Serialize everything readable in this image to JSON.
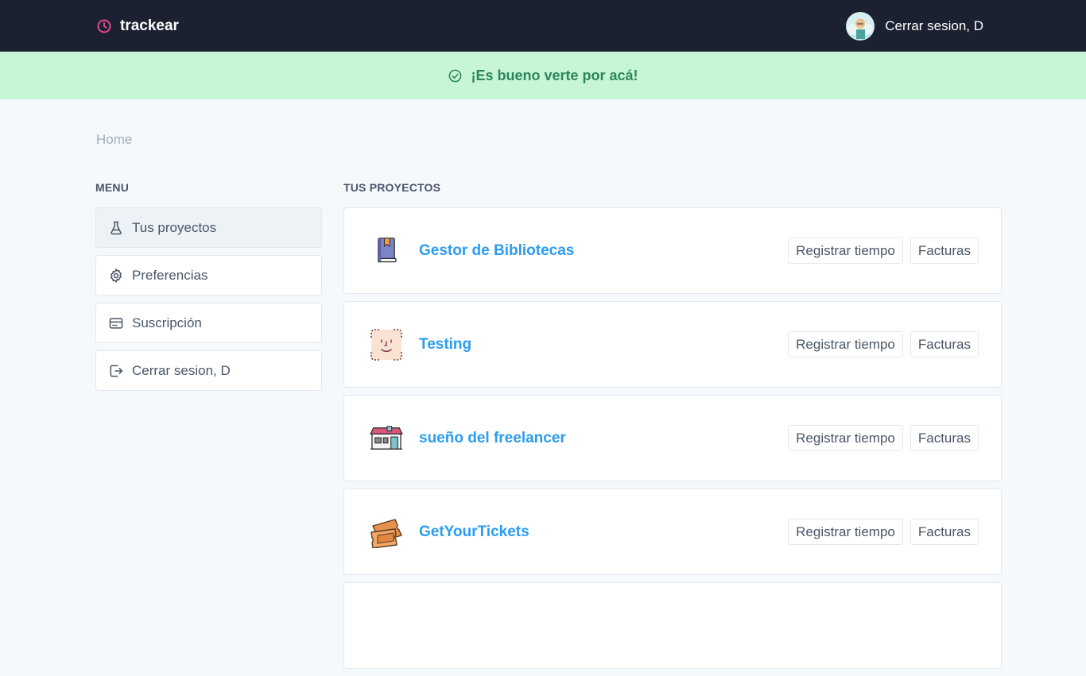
{
  "app": {
    "name": "trackear"
  },
  "header": {
    "user_label": "Cerrar sesion, D"
  },
  "flash": {
    "message": "¡Es bueno verte por acá!"
  },
  "breadcrumb": {
    "home": "Home"
  },
  "menu": {
    "title": "MENU",
    "items": [
      {
        "label": "Tus proyectos",
        "icon": "flask-icon"
      },
      {
        "label": "Preferencias",
        "icon": "gear-icon"
      },
      {
        "label": "Suscripción",
        "icon": "credit-card-icon"
      },
      {
        "label": "Cerrar sesion, D",
        "icon": "logout-icon"
      }
    ]
  },
  "projects": {
    "title": "TUS PROYECTOS",
    "items": [
      {
        "name": "Gestor de Bibliotecas",
        "icon": "book-icon",
        "register": "Registrar tiempo",
        "invoices": "Facturas"
      },
      {
        "name": "Testing",
        "icon": "face-scan-icon",
        "register": "Registrar tiempo",
        "invoices": "Facturas"
      },
      {
        "name": "sueño del freelancer",
        "icon": "house-icon",
        "register": "Registrar tiempo",
        "invoices": "Facturas"
      },
      {
        "name": "GetYourTickets",
        "icon": "ticket-icon",
        "register": "Registrar tiempo",
        "invoices": "Facturas"
      }
    ]
  },
  "colors": {
    "topbar": "#1b2130",
    "flash_bg": "#c6f6d5",
    "flash_text": "#2f855a",
    "link": "#2b9cf0",
    "brand_icon": "#e5488d"
  }
}
